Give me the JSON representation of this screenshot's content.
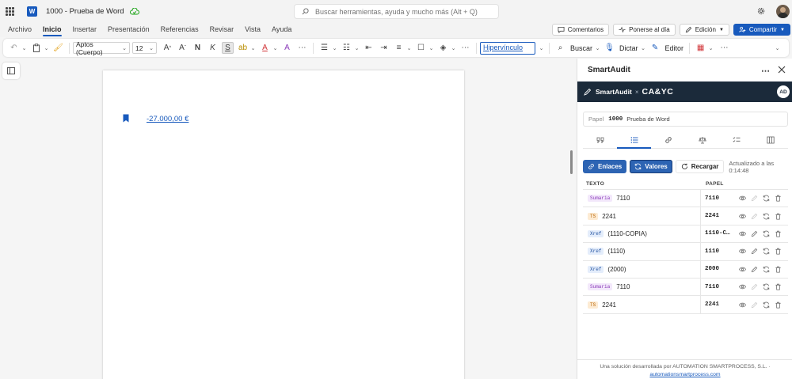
{
  "titlebar": {
    "doc_title": "1000 - Prueba de Word",
    "search_placeholder": "Buscar herramientas, ayuda y mucho más (Alt + Q)"
  },
  "menu": {
    "tabs": [
      {
        "label": "Archivo",
        "active": false
      },
      {
        "label": "Inicio",
        "active": true
      },
      {
        "label": "Insertar",
        "active": false
      },
      {
        "label": "Presentación",
        "active": false
      },
      {
        "label": "Referencias",
        "active": false
      },
      {
        "label": "Revisar",
        "active": false
      },
      {
        "label": "Vista",
        "active": false
      },
      {
        "label": "Ayuda",
        "active": false
      }
    ],
    "comments_label": "Comentarios",
    "catchup_label": "Ponerse al día",
    "edit_label": "Edición",
    "share_label": "Compartir"
  },
  "ribbon": {
    "font_name": "Aptos (Cuerpo)",
    "font_size": "12",
    "style_name": "Hipervínculo",
    "find_label": "Buscar",
    "dictate_label": "Dictar",
    "editor_label": "Editor"
  },
  "document": {
    "link_text": "-27.000,00 €"
  },
  "panel": {
    "title": "SmartAudit",
    "brand": "SmartAudit",
    "brand_sep": "×",
    "client_logo": "CA&YC",
    "avatar_initials": "AD",
    "papel_label": "Papel",
    "papel_code": "1000",
    "papel_name": "Prueba de Word",
    "actions": {
      "links_label": "Enlaces",
      "values_label": "Valores",
      "reload_label": "Recargar",
      "updated_text": "Actualizado a las 0:14:48"
    },
    "table": {
      "headers": [
        "TEXTO",
        "PAPEL"
      ],
      "rows": [
        {
          "tag": "Sumaria",
          "tag_type": "sumaria",
          "text": "7110",
          "papel": "7110"
        },
        {
          "tag": "TS",
          "tag_type": "ts",
          "text": "2241",
          "papel": "2241"
        },
        {
          "tag": "Xref",
          "tag_type": "xref",
          "text": "(1110-COPIA)",
          "papel": "1110-C…"
        },
        {
          "tag": "Xref",
          "tag_type": "xref",
          "text": "(1110)",
          "papel": "1110"
        },
        {
          "tag": "Xref",
          "tag_type": "xref",
          "text": "(2000)",
          "papel": "2000"
        },
        {
          "tag": "Sumaria",
          "tag_type": "sumaria",
          "text": "7110",
          "papel": "7110"
        },
        {
          "tag": "TS",
          "tag_type": "ts",
          "text": "2241",
          "papel": "2241"
        }
      ]
    },
    "footer_line1": "Una solución desarrollada por AUTOMATION SMARTPROCESS, S.L. ·",
    "footer_link": "automationsmartprocess.com"
  },
  "colors": {
    "accent": "#185abd",
    "addin_bar": "#1b2a3a",
    "button_blue": "#2d64b3"
  }
}
